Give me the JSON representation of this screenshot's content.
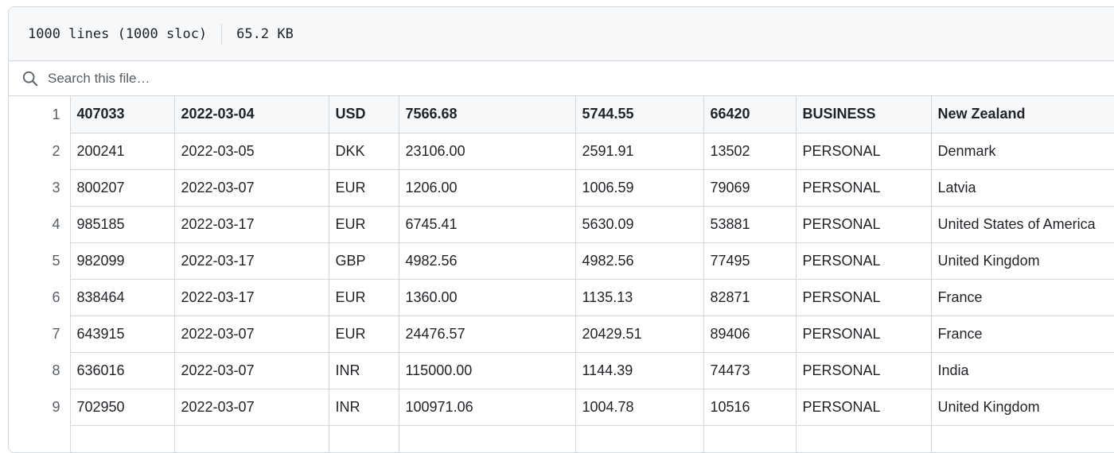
{
  "file_info": {
    "lines": "1000 lines (1000 sloc)",
    "size": "65.2 KB"
  },
  "search": {
    "icon": "search-icon",
    "placeholder": "Search this file…"
  },
  "table": {
    "rows": [
      {
        "line": "1",
        "cells": [
          "407033",
          "2022-03-04",
          "USD",
          "7566.68",
          "5744.55",
          "66420",
          "BUSINESS",
          "New Zealand"
        ]
      },
      {
        "line": "2",
        "cells": [
          "200241",
          "2022-03-05",
          "DKK",
          "23106.00",
          "2591.91",
          "13502",
          "PERSONAL",
          "Denmark"
        ]
      },
      {
        "line": "3",
        "cells": [
          "800207",
          "2022-03-07",
          "EUR",
          "1206.00",
          "1006.59",
          "79069",
          "PERSONAL",
          "Latvia"
        ]
      },
      {
        "line": "4",
        "cells": [
          "985185",
          "2022-03-17",
          "EUR",
          "6745.41",
          "5630.09",
          "53881",
          "PERSONAL",
          "United States of America"
        ]
      },
      {
        "line": "5",
        "cells": [
          "982099",
          "2022-03-17",
          "GBP",
          "4982.56",
          "4982.56",
          "77495",
          "PERSONAL",
          "United Kingdom"
        ]
      },
      {
        "line": "6",
        "cells": [
          "838464",
          "2022-03-17",
          "EUR",
          "1360.00",
          "1135.13",
          "82871",
          "PERSONAL",
          "France"
        ]
      },
      {
        "line": "7",
        "cells": [
          "643915",
          "2022-03-07",
          "EUR",
          "24476.57",
          "20429.51",
          "89406",
          "PERSONAL",
          "France"
        ]
      },
      {
        "line": "8",
        "cells": [
          "636016",
          "2022-03-07",
          "INR",
          "115000.00",
          "1144.39",
          "74473",
          "PERSONAL",
          "India"
        ]
      },
      {
        "line": "9",
        "cells": [
          "702950",
          "2022-03-07",
          "INR",
          "100971.06",
          "1004.78",
          "10516",
          "PERSONAL",
          "United Kingdom"
        ]
      },
      {
        "line": "",
        "cells": [
          "",
          "",
          "",
          "",
          "",
          "",
          "",
          ""
        ]
      }
    ]
  }
}
